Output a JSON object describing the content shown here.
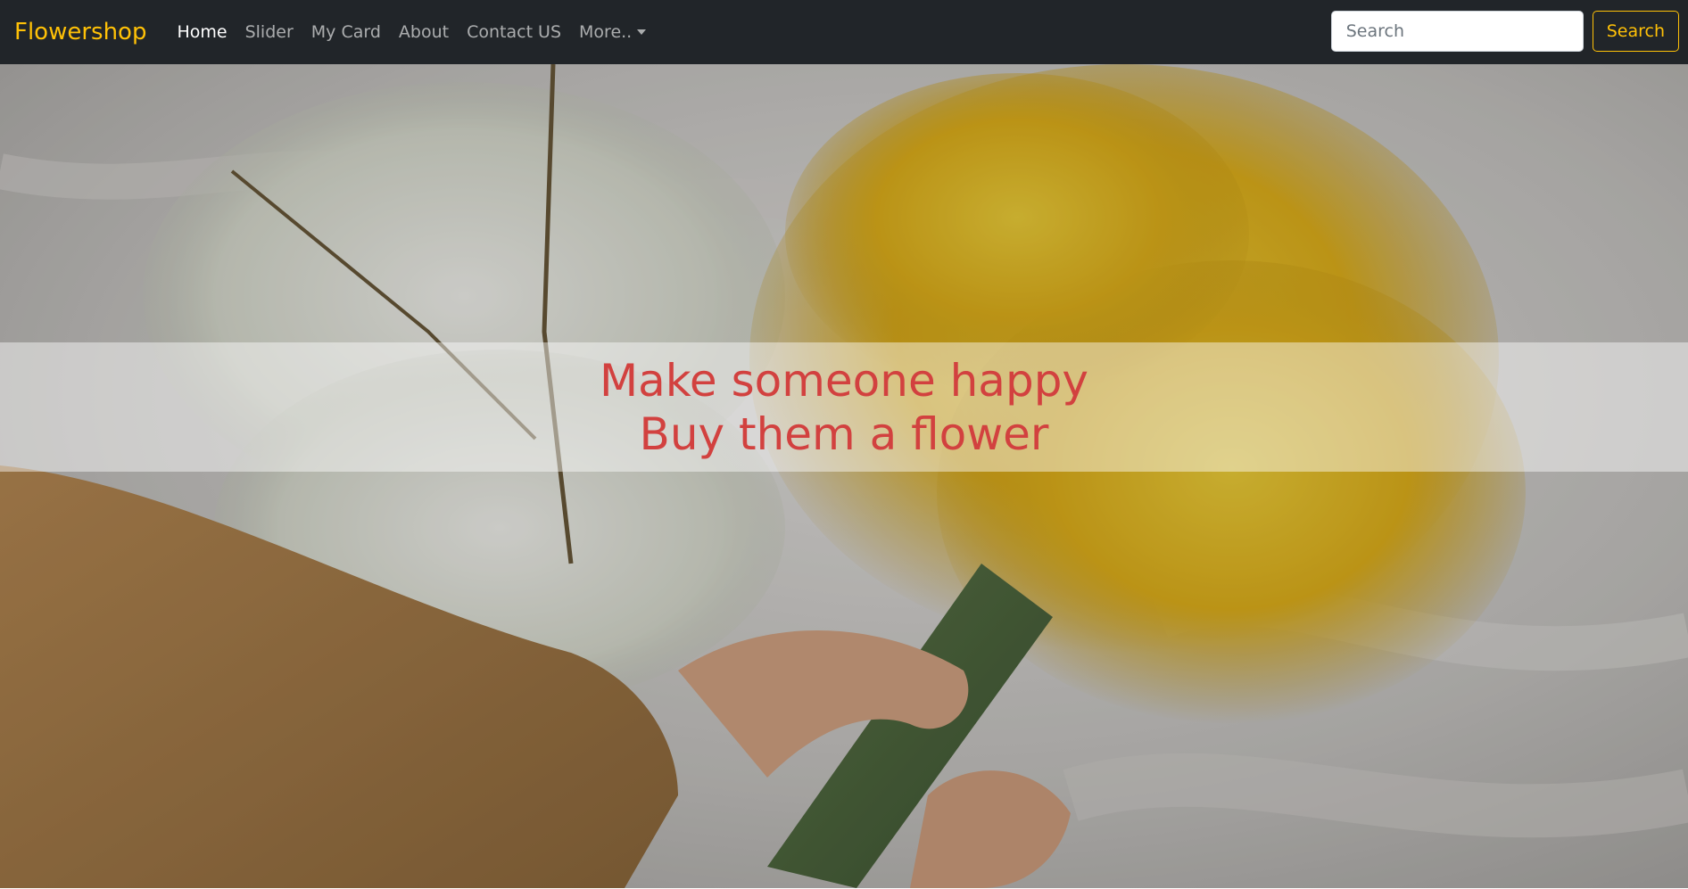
{
  "navbar": {
    "brand": "Flowershop",
    "links": [
      {
        "label": "Home",
        "active": true
      },
      {
        "label": "Slider",
        "active": false
      },
      {
        "label": "My Card",
        "active": false
      },
      {
        "label": "About",
        "active": false
      },
      {
        "label": "Contact US",
        "active": false
      },
      {
        "label": "More..",
        "active": false,
        "dropdown": true
      }
    ],
    "search": {
      "placeholder": "Search",
      "button_label": "Search"
    }
  },
  "hero": {
    "line1": "Make someone happy",
    "line2": "Buy them a flower",
    "image_subject": "hands holding a bouquet of yellow daffodils beside white blossom branches"
  },
  "colors": {
    "navbar_bg": "#212529",
    "brand": "#ffc107",
    "accent": "#ffc107",
    "caption_text": "#d2413f"
  }
}
